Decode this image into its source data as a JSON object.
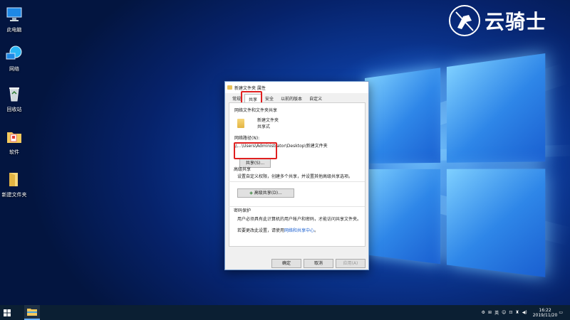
{
  "desktop": {
    "icons": [
      {
        "label": "此电脑",
        "icon": "computer-icon"
      },
      {
        "label": "网络",
        "icon": "network-icon"
      },
      {
        "label": "回收站",
        "icon": "recycle-bin-icon"
      },
      {
        "label": "软件",
        "icon": "software-folder-icon"
      },
      {
        "label": "新建文件夹",
        "icon": "folder-icon"
      }
    ]
  },
  "watermark": {
    "text": "云骑士"
  },
  "dialog": {
    "title": "新建文件夹 属性",
    "tabs": [
      "常规",
      "共享",
      "安全",
      "以前的版本",
      "自定义"
    ],
    "active_tab": "共享",
    "network_section": "网络文件和文件夹共享",
    "folder_name": "新建文件夹",
    "share_state": "共享式",
    "path_label": "网络路径(N):",
    "path_value": "\\\\…\\Users\\Administrator\\Desktop\\新建文件夹",
    "share_button": "共享(S)...",
    "advanced_section": "高级共享",
    "advanced_desc": "设置自定义权限，创建多个共享，并设置其他高级共享选项。",
    "advanced_button": "高级共享(D)...",
    "password_section": "密码保护",
    "password_desc": "用户必须具有此计算机的用户帐户和密码，才能访问共享文件夹。",
    "password_change_prefix": "若要更改此设置，请使用",
    "password_link": "网络和共享中心",
    "password_change_suffix": "。",
    "buttons": {
      "ok": "确定",
      "cancel": "取消",
      "apply": "应用(A)"
    },
    "highlight_color": "#e02020"
  },
  "taskbar": {
    "tray_lang": "英",
    "time": "16:22",
    "date": "2019/11/20"
  }
}
